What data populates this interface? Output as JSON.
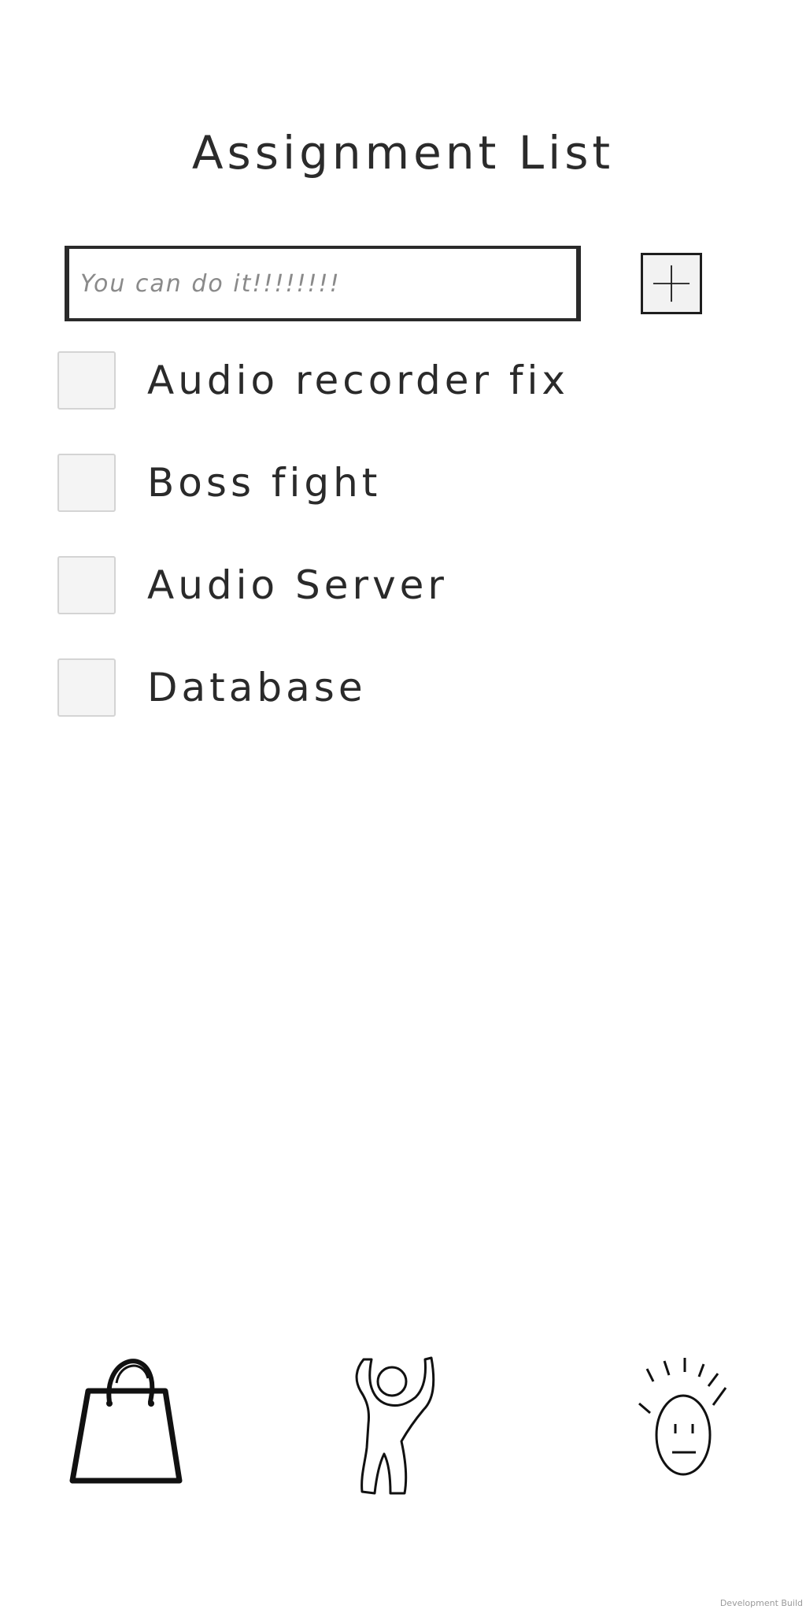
{
  "header": {
    "title": "Assignment List"
  },
  "new_task": {
    "placeholder": "You can do it!!!!!!!!",
    "value": "",
    "add_button_icon": "plus-icon"
  },
  "tasks": [
    {
      "label": "Audio recorder fix",
      "checked": false
    },
    {
      "label": "Boss fight",
      "checked": false
    },
    {
      "label": "Audio Server",
      "checked": false
    },
    {
      "label": "Database",
      "checked": false
    }
  ],
  "bottom_nav": [
    {
      "icon": "shopping-bag-icon"
    },
    {
      "icon": "dancing-person-icon"
    },
    {
      "icon": "face-icon"
    }
  ],
  "footer": {
    "build_label": "Development Build"
  }
}
